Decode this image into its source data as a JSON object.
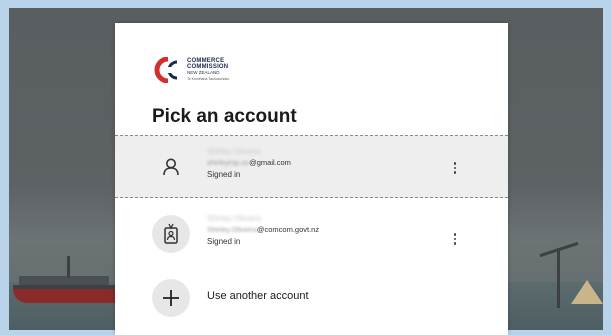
{
  "brand": {
    "logo_line1": "COMMERCE",
    "logo_line2": "COMMISSION",
    "logo_line3": "NEW ZEALAND",
    "logo_line4": "Te Komihana Tauhokohoko",
    "colors": {
      "red": "#d32f2f",
      "navy": "#1d2a4a"
    }
  },
  "dialog": {
    "title": "Pick an account"
  },
  "accounts": [
    {
      "name": "Shirley Oliveira",
      "email_prefix": "shirleymp.oz",
      "email_domain": "@gmail.com",
      "status": "Signed in",
      "icon": "person-icon",
      "selected": true
    },
    {
      "name": "Shirley Oliveira",
      "email_prefix": "Shirley.Oliveira",
      "email_domain": "@comcom.govt.nz",
      "status": "Signed in",
      "icon": "work-badge-icon",
      "selected": false
    }
  ],
  "add_account": {
    "label": "Use another account",
    "icon": "plus-icon"
  },
  "more_options_icon": "more-vertical-icon"
}
